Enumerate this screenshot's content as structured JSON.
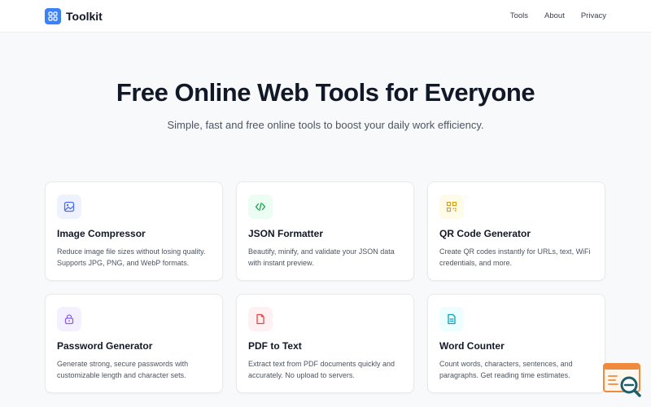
{
  "header": {
    "brand": "Toolkit",
    "nav": [
      "Tools",
      "About",
      "Privacy"
    ]
  },
  "hero": {
    "title": "Free Online Web Tools for Everyone",
    "subtitle": "Simple, fast and free online tools to boost your daily work efficiency."
  },
  "tools": [
    {
      "title": "Image Compressor",
      "desc": "Reduce image file sizes without losing quality. Supports JPG, PNG, and WebP formats.",
      "icon": "image-icon",
      "icon_bg": "#eef2ff",
      "icon_color": "#4f6ef7"
    },
    {
      "title": "JSON Formatter",
      "desc": "Beautify, minify, and validate your JSON data with instant preview.",
      "icon": "code-icon",
      "icon_bg": "#ecfdf3",
      "icon_color": "#16a34a"
    },
    {
      "title": "QR Code Generator",
      "desc": "Create QR codes instantly for URLs, text, WiFi credentials, and more.",
      "icon": "qr-code-icon",
      "icon_bg": "#fefbe8",
      "icon_color": "#d4a017"
    },
    {
      "title": "Password Generator",
      "desc": "Generate strong, secure passwords with customizable length and character sets.",
      "icon": "lock-icon",
      "icon_bg": "#f5f0ff",
      "icon_color": "#8b5cf6"
    },
    {
      "title": "PDF to Text",
      "desc": "Extract text from PDF documents quickly and accurately. No upload to servers.",
      "icon": "file-icon",
      "icon_bg": "#fff1f1",
      "icon_color": "#ef4444"
    },
    {
      "title": "Word Counter",
      "desc": "Count words, characters, sentences, and paragraphs. Get reading time estimates.",
      "icon": "document-text-icon",
      "icon_bg": "#ecfeff",
      "icon_color": "#0e9fb5"
    }
  ],
  "colors": {
    "brand": "#3b82f6",
    "background": "#f8f9fb",
    "badge_orange": "#f08a3c",
    "badge_teal": "#1f5f6b"
  }
}
